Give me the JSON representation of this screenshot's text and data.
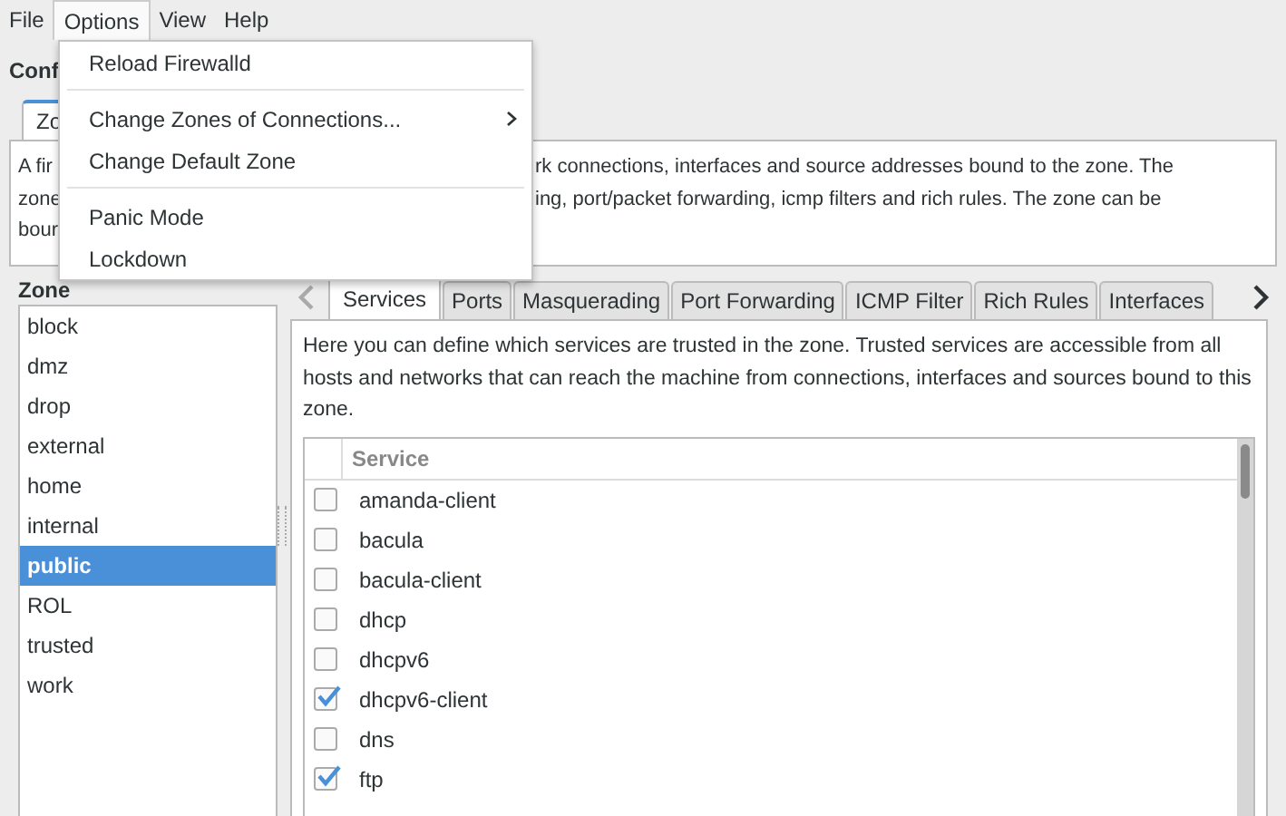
{
  "menubar": [
    {
      "label": "File",
      "selected": false
    },
    {
      "label": "Options",
      "selected": true
    },
    {
      "label": "View",
      "selected": false
    },
    {
      "label": "Help",
      "selected": false
    }
  ],
  "options_menu": {
    "groups": [
      [
        {
          "label": "Reload Firewalld",
          "has_submenu": false
        }
      ],
      [
        {
          "label": "Change Zones of Connections...",
          "has_submenu": true
        },
        {
          "label": "Change Default Zone",
          "has_submenu": false
        }
      ],
      [
        {
          "label": "Panic Mode",
          "has_submenu": false
        },
        {
          "label": "Lockdown",
          "has_submenu": false
        }
      ]
    ]
  },
  "heading": "Conf",
  "outer_tabs": [
    {
      "label": "Zo",
      "selected": true
    }
  ],
  "zone_description": {
    "left_lines": [
      "A fir",
      "zone",
      "bour"
    ],
    "right_lines": [
      "rk connections, interfaces and source addresses bound to the zone. The",
      "ing, port/packet forwarding, icmp filters and rich rules. The zone can be"
    ]
  },
  "zone_list": {
    "title": "Zone",
    "items": [
      {
        "label": "block",
        "selected": false
      },
      {
        "label": "dmz",
        "selected": false
      },
      {
        "label": "drop",
        "selected": false
      },
      {
        "label": "external",
        "selected": false
      },
      {
        "label": "home",
        "selected": false
      },
      {
        "label": "internal",
        "selected": false
      },
      {
        "label": "public",
        "selected": true
      },
      {
        "label": "ROL",
        "selected": false
      },
      {
        "label": "trusted",
        "selected": false
      },
      {
        "label": "work",
        "selected": false
      }
    ]
  },
  "tab_scroll": {
    "left_disabled": true,
    "right_disabled": false
  },
  "zone_tabs": [
    {
      "label": "Services",
      "selected": true
    },
    {
      "label": "Ports",
      "selected": false
    },
    {
      "label": "Masquerading",
      "selected": false
    },
    {
      "label": "Port Forwarding",
      "selected": false
    },
    {
      "label": "ICMP Filter",
      "selected": false
    },
    {
      "label": "Rich Rules",
      "selected": false
    },
    {
      "label": "Interfaces",
      "selected": false
    }
  ],
  "services": {
    "description": "Here you can define which services are trusted in the zone. Trusted services are accessible from all hosts and networks that can reach the machine from connections, interfaces and sources bound to this zone.",
    "columns": [
      "Service"
    ],
    "rows": [
      {
        "name": "amanda-client",
        "checked": false
      },
      {
        "name": "bacula",
        "checked": false
      },
      {
        "name": "bacula-client",
        "checked": false
      },
      {
        "name": "dhcp",
        "checked": false
      },
      {
        "name": "dhcpv6",
        "checked": false
      },
      {
        "name": "dhcpv6-client",
        "checked": true
      },
      {
        "name": "dns",
        "checked": false
      },
      {
        "name": "ftp",
        "checked": true
      }
    ]
  }
}
